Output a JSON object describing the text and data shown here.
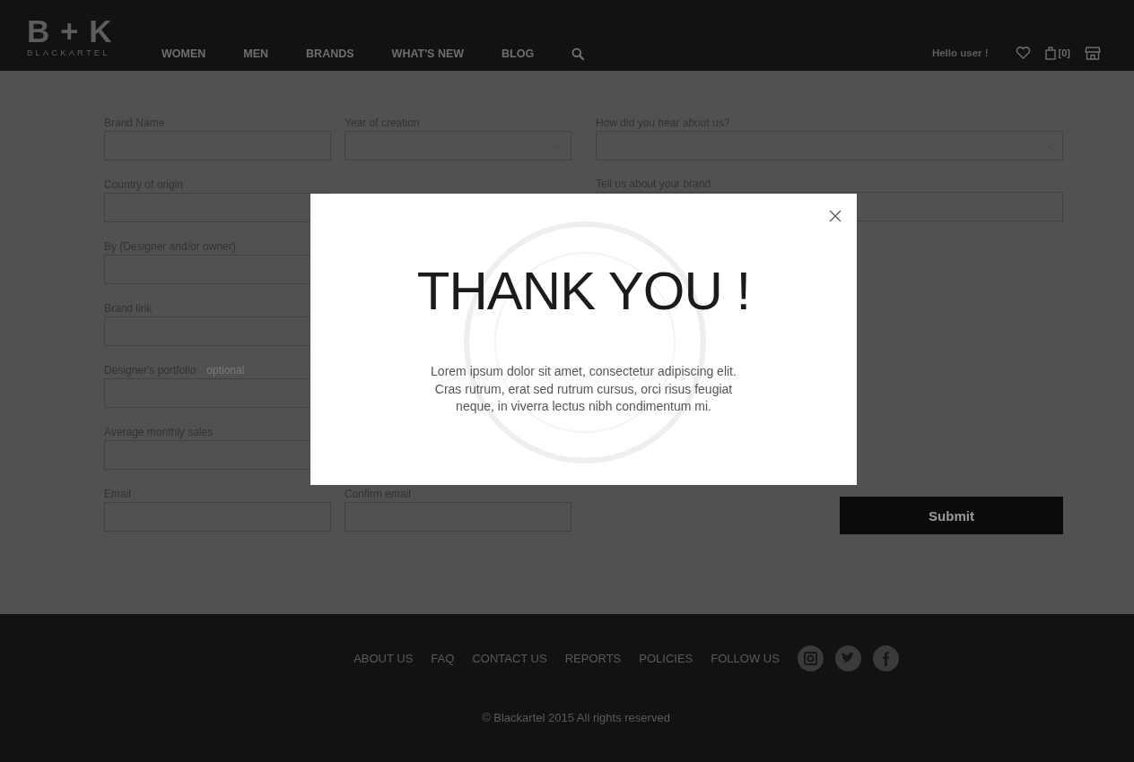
{
  "header": {
    "logo": {
      "mark": "B + K",
      "name": "BLACKARTEL"
    },
    "menu": [
      "WOMEN",
      "MEN",
      "BRANDS",
      "WHAT'S NEW",
      "BLOG"
    ],
    "greeting": "Hello user !",
    "cart_count": "[0]"
  },
  "form": {
    "left_rows": [
      [
        {
          "label": "Brand Name",
          "kind": "text"
        },
        {
          "label": "Year of creation",
          "kind": "select"
        }
      ],
      [
        {
          "label": "Country of origin",
          "kind": "text"
        }
      ],
      [
        {
          "label": "By (Designer and/or owner)",
          "kind": "text"
        }
      ],
      [
        {
          "label": "Brand link",
          "kind": "text"
        }
      ],
      [
        {
          "label": "Designer's portfolio",
          "hint": "optional",
          "kind": "text"
        }
      ],
      [
        {
          "label": "Average monthly sales",
          "kind": "text"
        }
      ],
      [
        {
          "label": "Email",
          "kind": "text"
        },
        {
          "label": "Confirm email",
          "kind": "text"
        }
      ]
    ],
    "right_fields": [
      {
        "label": "How did you hear about us?",
        "kind": "select"
      },
      {
        "label": "Tell us about your brand",
        "kind": "text"
      }
    ],
    "submit": "Submit"
  },
  "modal": {
    "title": "THANK YOU !",
    "message": "Lorem ipsum dolor sit amet, consectetur adipiscing elit. Cras rutrum, erat sed rutrum cursus, orci risus feugiat neque, in viverra lectus nibh condimentum mi."
  },
  "footer": {
    "links": [
      "ABOUT US",
      "FAQ",
      "CONTACT US",
      "REPORTS",
      "POLICIES",
      "FOLLOW US"
    ],
    "social": [
      {
        "kind": "instagram"
      },
      {
        "kind": "twitter"
      },
      {
        "kind": "facebook"
      }
    ],
    "copyright": "© Blackartel 2015 All rights reserved"
  }
}
